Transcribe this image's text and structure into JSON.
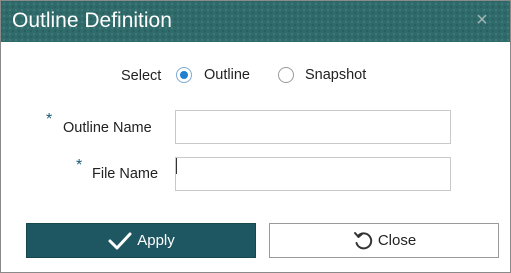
{
  "dialog": {
    "title": "Outline Definition",
    "close_symbol": "×"
  },
  "select": {
    "label": "Select",
    "options": [
      {
        "label": "Outline",
        "checked": true
      },
      {
        "label": "Snapshot",
        "checked": false
      }
    ]
  },
  "fields": {
    "required_marker": "*",
    "outline_name": {
      "label": "Outline Name",
      "value": ""
    },
    "file_name": {
      "label": "File Name",
      "value": ""
    }
  },
  "buttons": {
    "apply": {
      "label": "Apply",
      "icon": "checkmark-icon"
    },
    "close": {
      "label": "Close",
      "icon": "undo-icon"
    }
  },
  "colors": {
    "titlebar": "#2f6b6a",
    "primary_button": "#1e5761",
    "radio_selected": "#1f7fd0",
    "required_marker": "#1a5a73"
  }
}
